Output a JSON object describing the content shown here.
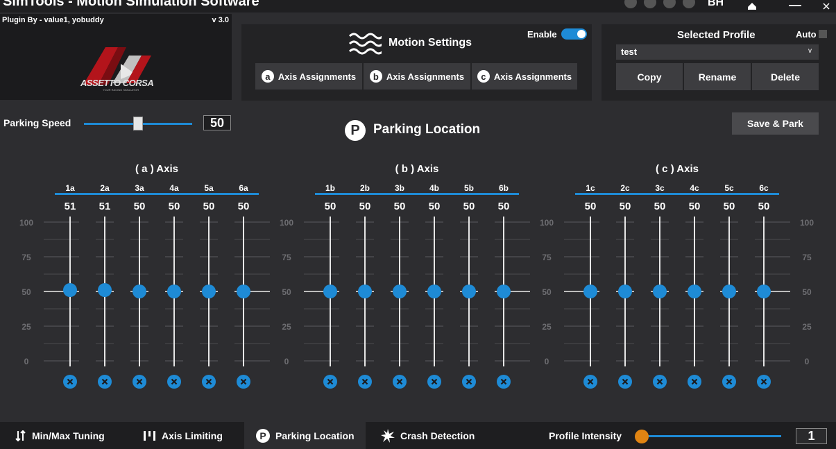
{
  "titlebar": {
    "title": "SimTools - Motion Simulation Software",
    "user": "BH"
  },
  "plugin": {
    "by": "Plugin By - value1, yobuddy",
    "version": "v 3.0",
    "logo_icon": "assetto-corsa-logo",
    "logo_text": "ASSETTO CORSA",
    "logo_sub": "YOUR RACING SIMULATOR"
  },
  "motion": {
    "title": "Motion Settings",
    "enable_label": "Enable",
    "enabled": true,
    "axis_buttons": [
      {
        "letter": "a",
        "label": "Axis Assignments"
      },
      {
        "letter": "b",
        "label": "Axis Assignments"
      },
      {
        "letter": "c",
        "label": "Axis Assignments"
      }
    ]
  },
  "profile": {
    "title": "Selected Profile",
    "auto_label": "Auto",
    "selected": "test",
    "copy": "Copy",
    "rename": "Rename",
    "delete": "Delete"
  },
  "parking": {
    "speed_label": "Parking Speed",
    "speed_value": "50",
    "speed": 50,
    "speed_max": 100,
    "title": "Parking Location",
    "icon_letter": "P",
    "save_park": "Save & Park"
  },
  "scale_labels": [
    "100",
    "75",
    "50",
    "25",
    "0"
  ],
  "axis_groups": [
    {
      "title": "( a ) Axis",
      "axes": [
        {
          "name": "1a",
          "value": 51
        },
        {
          "name": "2a",
          "value": 51
        },
        {
          "name": "3a",
          "value": 50
        },
        {
          "name": "4a",
          "value": 50
        },
        {
          "name": "5a",
          "value": 50
        },
        {
          "name": "6a",
          "value": 50
        }
      ]
    },
    {
      "title": "( b ) Axis",
      "axes": [
        {
          "name": "1b",
          "value": 50
        },
        {
          "name": "2b",
          "value": 50
        },
        {
          "name": "3b",
          "value": 50
        },
        {
          "name": "4b",
          "value": 50
        },
        {
          "name": "5b",
          "value": 50
        },
        {
          "name": "6b",
          "value": 50
        }
      ]
    },
    {
      "title": "( c ) Axis",
      "axes": [
        {
          "name": "1c",
          "value": 50
        },
        {
          "name": "2c",
          "value": 50
        },
        {
          "name": "3c",
          "value": 50
        },
        {
          "name": "4c",
          "value": 50
        },
        {
          "name": "5c",
          "value": 50
        },
        {
          "name": "6c",
          "value": 50
        }
      ]
    }
  ],
  "bottom": {
    "tabs": [
      {
        "label": "Min/Max Tuning",
        "icon": "min-max-arrows-icon"
      },
      {
        "label": "Axis Limiting",
        "icon": "axis-limiting-bars-icon"
      },
      {
        "label": "Parking Location",
        "icon": "parking-p-icon",
        "active": true
      },
      {
        "label": "Crash Detection",
        "icon": "crash-burst-icon"
      }
    ],
    "intensity_label": "Profile Intensity",
    "intensity_value": "1",
    "intensity": 1,
    "intensity_max": 100
  },
  "colors": {
    "accent": "#1e8bd6",
    "orange": "#e08412",
    "bg": "#2d2d30"
  }
}
